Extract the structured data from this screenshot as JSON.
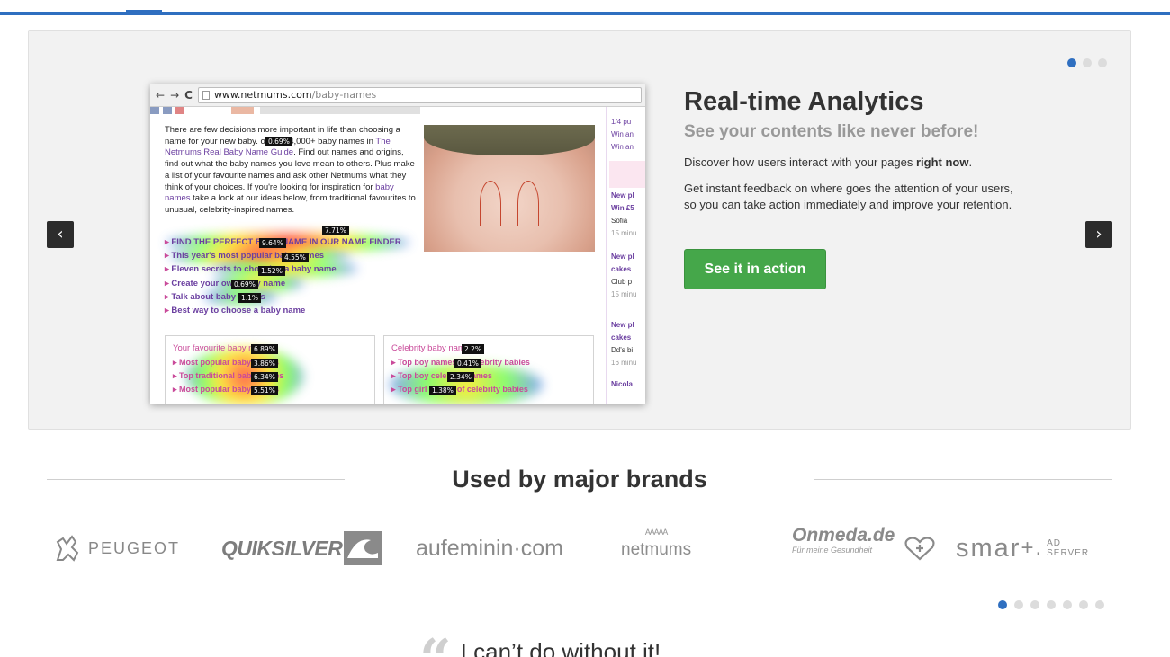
{
  "slider": {
    "browser": {
      "url_domain": "www.netmums.com",
      "url_path": "/baby-names",
      "nav_back": "←",
      "nav_forward": "→",
      "nav_reload": "C",
      "intro_part1": "There are few decisions more important in life than choosing a name for your new baby.",
      "intro_part2": "out the 4,000+ baby names in",
      "intro_link": "The Netmums Real Baby Name Guide",
      "intro_part3": ". Find out names and origins, find out what the baby names you love mean to others. Plus make a list of your favourite names and ask other Netmums what they think of your choices. If you're looking for inspiration for",
      "intro_link2": "baby names",
      "intro_part4": "take a look at our ideas below, from traditional favourites to unusual, celebrity-inspired names.",
      "links": [
        "FIND THE PERFECT BABY NAME IN OUR NAME FINDER",
        "This year's most popular baby names",
        "Eleven secrets to choosing a baby name",
        "Create your own baby name",
        "Talk about baby names",
        "Best way to choose a baby name"
      ],
      "box1_title": "Your favourite baby names",
      "box1_items": [
        "Most popular baby names",
        "Top traditional baby names",
        "Most popular baby names"
      ],
      "box2_title": "Celebrity baby names",
      "box2_items": [
        "Top boy names of celebrity babies",
        "Top boy celebrity names",
        "Top girl names of celebrity babies"
      ],
      "tags": [
        "0.69%",
        "9.64%",
        "7.71%",
        "4.55%",
        "1.52%",
        "0.69%",
        "1.1%",
        "6.89%",
        "3.86%",
        "6.34%",
        "5.51%",
        "2.2%",
        "0.41%",
        "2.34%",
        "1.38%"
      ],
      "side_items": [
        "1/4 pu",
        "Win an",
        "Win an",
        "New pl",
        "Win £5",
        "Sofia",
        "15 minu",
        "New pl",
        "cakes",
        "Club p",
        "15 minu",
        "New pl",
        "cakes",
        "Dd's bi",
        "16 minu",
        "Nicola"
      ]
    },
    "title": "Real-time Analytics",
    "subtitle": "See your contents like never before!",
    "p1_prefix": "Discover how users interact with your pages ",
    "p1_bold": "right now",
    "p1_suffix": ".",
    "p2": "Get instant feedback on where goes the attention of your users, so you can take action immediately and improve your retention.",
    "cta_label": "See it in action",
    "prev_label": "‹",
    "next_label": "›",
    "dots_total": 3,
    "dots_active_index": 0
  },
  "brands": {
    "title": "Used by major brands",
    "logos": {
      "peugeot": "PEUGEOT",
      "quiksilver": "QUIKSILVER",
      "aufeminin": "aufeminin·com",
      "netmums": "netmums",
      "onmeda": "Onmeda.de",
      "onmeda_tagline": "Für meine Gesundheit",
      "smart": "smar",
      "smart_plus": "+.",
      "smart_ad": "AD",
      "smart_server": "SERVER"
    },
    "dots_total": 7,
    "dots_active_index": 0
  },
  "testimonial": {
    "quote_mark": "“",
    "text": "I can’t do without it!"
  },
  "colors": {
    "accent_blue": "#2f6fc0",
    "cta_green": "#45a74a",
    "heat_red": "#ff2a1a",
    "heat_yellow": "#ffe300",
    "heat_green": "#64ff3c",
    "heat_blue": "#5a7dff"
  }
}
